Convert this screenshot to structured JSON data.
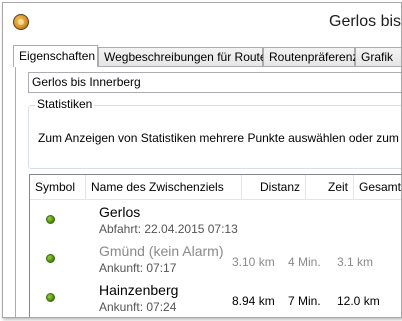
{
  "window": {
    "title": "Gerlos bis"
  },
  "tabs": [
    {
      "label": "Eigenschaften"
    },
    {
      "label": "Wegbeschreibungen für Routen"
    },
    {
      "label": "Routenpräferenz"
    },
    {
      "label": "Grafik"
    }
  ],
  "route_name": "Gerlos bis Innerberg",
  "statistics": {
    "label": "Statistiken",
    "message": "Zum Anzeigen von Statistiken mehrere Punkte auswählen oder zum Anzeige"
  },
  "grid": {
    "columns": {
      "symbol": "Symbol",
      "name": "Name des Zwischenziels",
      "distance": "Distanz",
      "time": "Zeit",
      "total": "Gesamtdistan"
    },
    "rows": [
      {
        "name": "Gerlos",
        "sub": "Abfahrt: 22.04.2015 07:13",
        "distance": "",
        "time": "",
        "total": "",
        "muted": false
      },
      {
        "name": "Gmünd (kein Alarm)",
        "sub": "Ankunft: 07:17",
        "distance": "3.10 km",
        "time": "4 Min.",
        "total": "3.1 km",
        "muted": true
      },
      {
        "name": "Hainzenberg",
        "sub": "Ankunft: 07:24",
        "distance": "8.94 km",
        "time": "7 Min.",
        "total": "12.0 km",
        "muted": false
      }
    ]
  },
  "colors": {
    "waypoint_dot": "#4f8f12",
    "muted_text": "#8a8a8a"
  },
  "icons": {
    "app": "app-globe-icon",
    "waypoint": "green-dot-icon"
  }
}
